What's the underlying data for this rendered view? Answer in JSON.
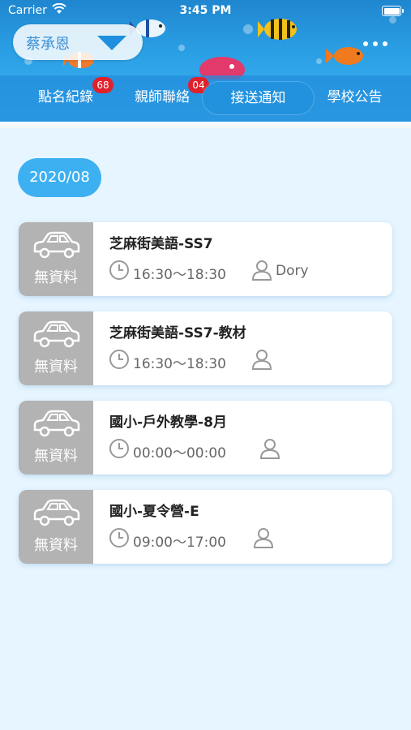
{
  "status_bar": {
    "carrier": "Carrier",
    "time": "3:45 PM"
  },
  "student": {
    "name": "蔡承恩"
  },
  "tabs": [
    {
      "label": "點名紀錄",
      "badge": "68"
    },
    {
      "label": "親師聯絡",
      "badge": "04"
    },
    {
      "label": "接送通知",
      "badge": ""
    },
    {
      "label": "學校公告",
      "badge": ""
    }
  ],
  "active_tab": "接送通知",
  "month": "2020/08",
  "cards": [
    {
      "status": "無資料",
      "title": "芝麻街美語-SS7",
      "time": "16:30～18:30",
      "teacher": "Dory"
    },
    {
      "status": "無資料",
      "title": "芝麻街美語-SS7-教材",
      "time": "16:30～18:30",
      "teacher": ""
    },
    {
      "status": "無資料",
      "title": "國小-戶外教學-8月",
      "time": "00:00～00:00",
      "teacher": ""
    },
    {
      "status": "無資料",
      "title": "國小-夏令營-E",
      "time": "09:00～17:00",
      "teacher": ""
    }
  ],
  "colors": {
    "header": "#2a9ee4",
    "accent": "#3db0f2",
    "badge": "#e0212b",
    "card_left": "#b3b3b3",
    "background": "#e6f5ff"
  },
  "icons": [
    "wifi-icon",
    "battery-icon",
    "dropdown-arrow-icon",
    "more-icon",
    "car-icon",
    "clock-icon",
    "person-icon"
  ]
}
